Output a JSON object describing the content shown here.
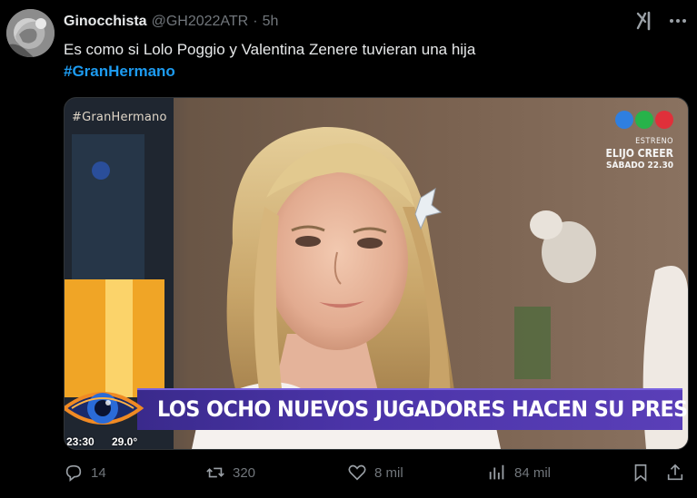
{
  "tweet": {
    "display_name": "Ginocchista",
    "handle": "@GH2022ATR",
    "separator": "·",
    "time": "5h",
    "text": "Es como si Lolo Poggio y Valentina Zenere tuvieran una hija",
    "hashtag": "#GranHermano"
  },
  "media": {
    "tv_hashtag": "#GranHermano",
    "promo": {
      "line1": "ESTRENO",
      "line2": "ELIJO CREER",
      "line3": "SÁBADO 22.30"
    },
    "lower_third": "LOS OCHO NUEVOS JUGADORES HACEN SU PRESENTACIÓN",
    "clock": "23:30",
    "temperature": "29.0°",
    "telefe_colors": [
      "#2f7fe0",
      "#27b34a",
      "#e0303a"
    ]
  },
  "actions": {
    "replies": "14",
    "retweets": "320",
    "likes": "8 mil",
    "views": "84 mil"
  },
  "icons": {
    "grok": "grok-icon",
    "more": "more-icon",
    "reply": "reply-icon",
    "retweet": "retweet-icon",
    "like": "heart-icon",
    "views": "views-icon",
    "bookmark": "bookmark-icon",
    "share": "share-icon"
  },
  "colors": {
    "background": "#000000",
    "text": "#e7e9ea",
    "muted": "#71767b",
    "link": "#1d9bf0",
    "banner": "#4b34a8"
  }
}
